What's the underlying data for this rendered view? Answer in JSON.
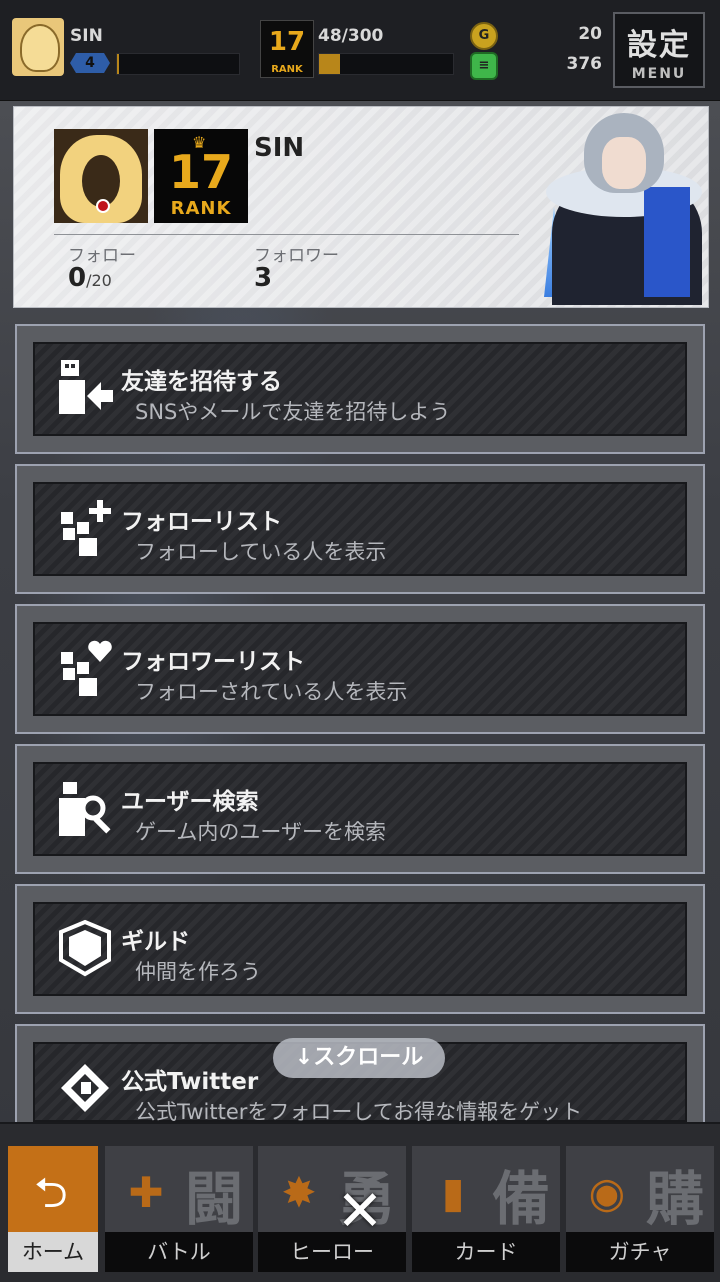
{
  "topbar": {
    "player_name": "SIN",
    "level": "4",
    "exp": "48/300",
    "exp_fraction": 0.16,
    "level_bar_fraction": 0.02,
    "rank_number": "17",
    "rank_label": "RANK",
    "coins": "20",
    "gems": "376",
    "menu_kanji": "設定",
    "menu_label": "MENU"
  },
  "profile": {
    "name": "SIN",
    "rank_number": "17",
    "rank_label": "RANK",
    "follow_label": "フォロー",
    "follow_value": "0",
    "follow_max": "/20",
    "follower_label": "フォロワー",
    "follower_value": "3"
  },
  "menu": [
    {
      "icon": "invite-friend-icon",
      "title": "友達を招待する",
      "subtitle": "SNSやメールで友達を招待しよう"
    },
    {
      "icon": "follow-list-icon",
      "title": "フォローリスト",
      "subtitle": "フォローしている人を表示"
    },
    {
      "icon": "follower-list-icon",
      "title": "フォロワーリスト",
      "subtitle": "フォローされている人を表示"
    },
    {
      "icon": "user-search-icon",
      "title": "ユーザー検索",
      "subtitle": "ゲーム内のユーザーを検索"
    },
    {
      "icon": "guild-shield-icon",
      "title": "ギルド",
      "subtitle": "仲間を作ろう"
    },
    {
      "icon": "twitter-logo-icon",
      "title": "公式Twitter",
      "subtitle": "公式Twitterをフォローしてお得な情報をゲット"
    }
  ],
  "scroll_hint": "↓スクロール",
  "nav": [
    {
      "label": "ホーム",
      "kanji": "",
      "icon": "home-icon"
    },
    {
      "label": "バトル",
      "kanji": "闘",
      "icon": "gamepad-icon"
    },
    {
      "label": "ヒーロー",
      "kanji": "勇",
      "icon": "hero-icon"
    },
    {
      "label": "カード",
      "kanji": "備",
      "icon": "card-icon"
    },
    {
      "label": "ガチャ",
      "kanji": "購",
      "icon": "gacha-icon"
    }
  ],
  "close_symbol": "✕",
  "colors": {
    "accent": "#c47017",
    "rank_gold": "#e8a91c",
    "level_blue": "#2e5da8"
  }
}
